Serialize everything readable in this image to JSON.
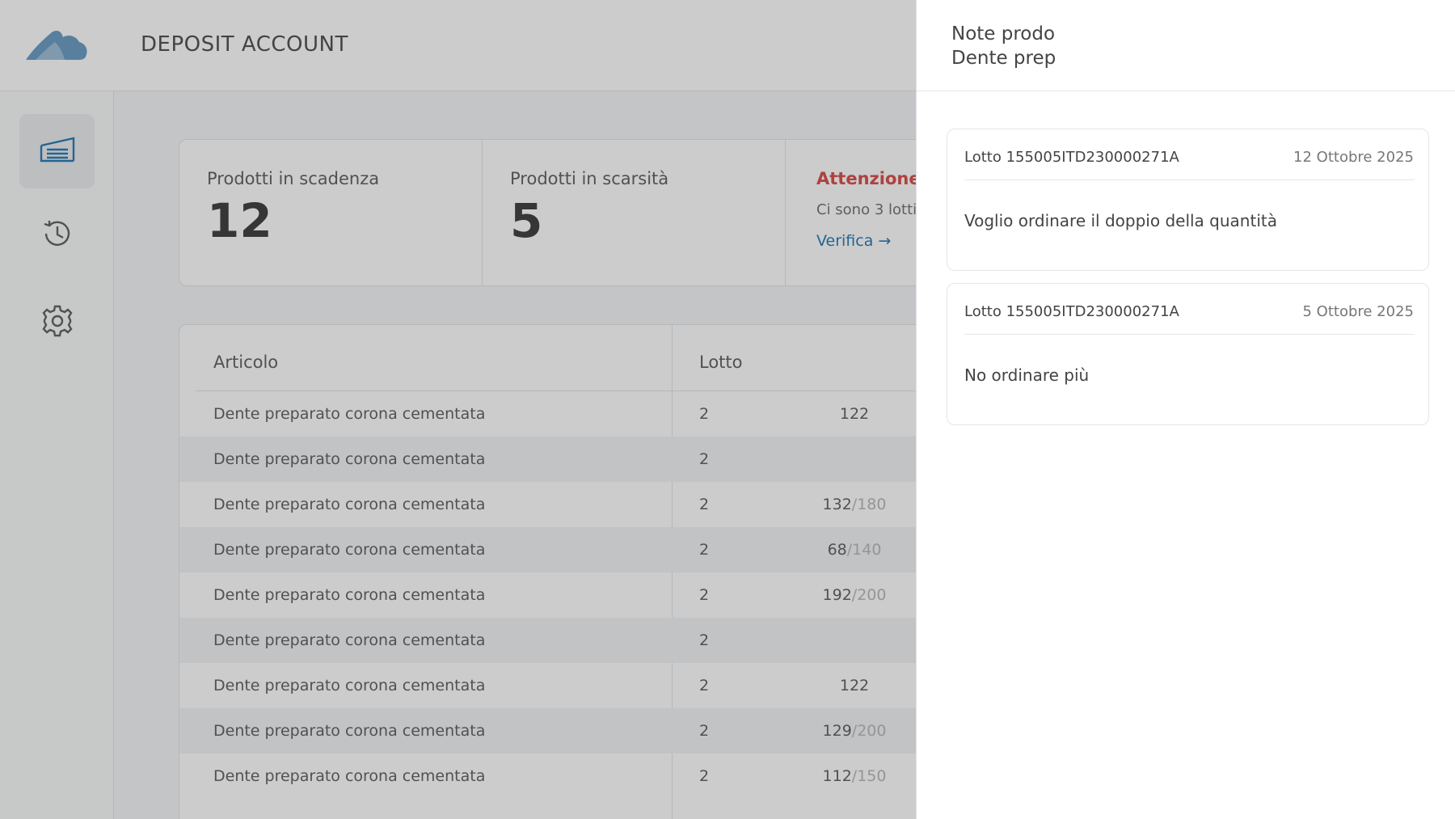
{
  "app": {
    "title": "DEPOSIT ACCOUNT",
    "brand_color": "#2d7fb8"
  },
  "sidebar": {
    "items": [
      {
        "icon": "warehouse-icon",
        "active": true
      },
      {
        "icon": "history-icon",
        "active": false
      },
      {
        "icon": "gear-icon",
        "active": false
      }
    ]
  },
  "stats": {
    "expiring": {
      "label": "Prodotti in scadenza",
      "value": "12"
    },
    "scarce": {
      "label": "Prodotti in scarsità",
      "value": "5"
    },
    "warning": {
      "title": "Attenzione!",
      "text": "Ci sono 3 lotti",
      "link": "Verifica →",
      "color": "#d9534f"
    }
  },
  "table": {
    "headers": {
      "articolo": "Articolo",
      "lotto": "Lotto"
    },
    "rows": [
      {
        "articolo": "Dente preparato corona cementata",
        "lotto": "2",
        "qty": "122",
        "max": ""
      },
      {
        "articolo": "Dente preparato corona cementata",
        "lotto": "2",
        "qty": "",
        "max": ""
      },
      {
        "articolo": "Dente preparato corona cementata",
        "lotto": "2",
        "qty": "132",
        "max": "/180"
      },
      {
        "articolo": "Dente preparato corona cementata",
        "lotto": "2",
        "qty": "68",
        "max": "/140"
      },
      {
        "articolo": "Dente preparato corona cementata",
        "lotto": "2",
        "qty": "192",
        "max": "/200"
      },
      {
        "articolo": "Dente preparato corona cementata",
        "lotto": "2",
        "qty": "",
        "max": ""
      },
      {
        "articolo": "Dente preparato corona cementata",
        "lotto": "2",
        "qty": "122",
        "max": ""
      },
      {
        "articolo": "Dente preparato corona cementata",
        "lotto": "2",
        "qty": "129",
        "max": "/200"
      },
      {
        "articolo": "Dente preparato corona cementata",
        "lotto": "2",
        "qty": "112",
        "max": "/150"
      }
    ]
  },
  "panel": {
    "title_line1": "Note prodo",
    "title_line2": "Dente prep",
    "notes": [
      {
        "lot": "Lotto 155005ITD230000271A",
        "date": "12 Ottobre 2025",
        "text": "Voglio ordinare il doppio della quantità"
      },
      {
        "lot": "Lotto 155005ITD230000271A",
        "date": "5 Ottobre 2025",
        "text": "No ordinare più"
      }
    ]
  }
}
